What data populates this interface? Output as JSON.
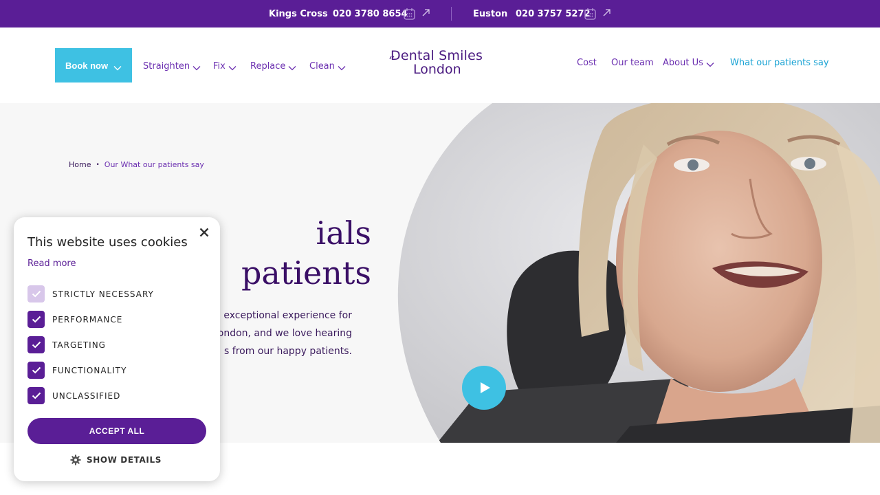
{
  "topbar": {
    "locations": [
      {
        "name": "Kings Cross",
        "phone": "020 3780 8654"
      },
      {
        "name": "Euston",
        "phone": "020 3757 5272"
      }
    ]
  },
  "nav": {
    "book_label": "Book now",
    "left_items": [
      "Straighten",
      "Fix",
      "Replace",
      "Clean"
    ],
    "right_items": [
      "Cost",
      "Our team",
      "About Us",
      "What our patients say"
    ]
  },
  "logo": {
    "line1": "Dental Smiles",
    "line2": "London"
  },
  "hero": {
    "breadcrumb": {
      "home": "Home",
      "current": "Our What our patients say"
    },
    "title_line1": "ials",
    "title_line2": "patients",
    "text_line1": "an exceptional experience for",
    "text_line2": "London, and we love hearing",
    "text_line3": "s from our happy patients."
  },
  "cookie": {
    "title": "This website uses cookies",
    "read_more": "Read more",
    "options": [
      {
        "label": "STRICTLY NECESSARY",
        "checked": true,
        "disabled": true
      },
      {
        "label": "PERFORMANCE",
        "checked": true,
        "disabled": false
      },
      {
        "label": "TARGETING",
        "checked": true,
        "disabled": false
      },
      {
        "label": "FUNCTIONALITY",
        "checked": true,
        "disabled": false
      },
      {
        "label": "UNCLASSIFIED",
        "checked": true,
        "disabled": false
      }
    ],
    "accept_label": "ACCEPT ALL",
    "show_details_label": "SHOW DETAILS"
  },
  "colors": {
    "brand_purple": "#5a1e96",
    "accent_blue": "#3ec1e3",
    "active_link": "#1aa3d4"
  },
  "icons": [
    "calendar-icon",
    "arrow-up-right-icon",
    "chevron-down-icon",
    "play-icon",
    "close-icon",
    "gear-icon",
    "checkmark-icon"
  ]
}
